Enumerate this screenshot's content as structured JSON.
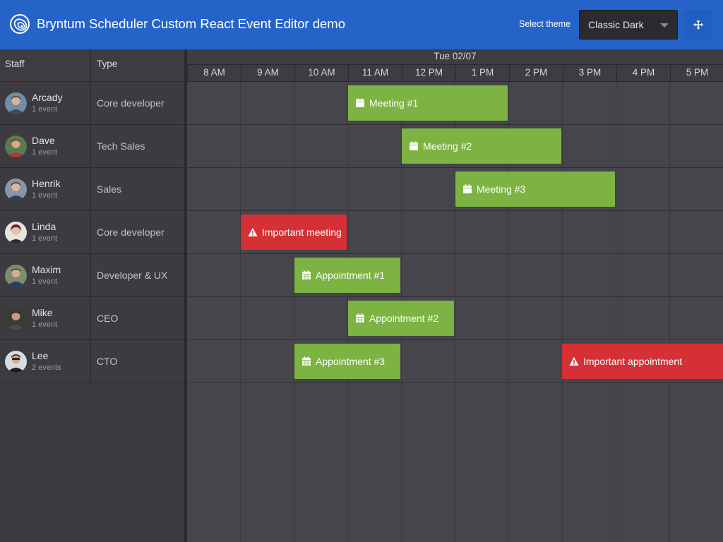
{
  "header": {
    "title": "Bryntum Scheduler Custom React Event Editor demo",
    "theme_label": "Select theme",
    "theme_value": "Classic Dark",
    "colors": {
      "background": "#2563c9",
      "button": "#1f5fc4"
    }
  },
  "grid": {
    "columns": {
      "staff": "Staff",
      "type": "Type"
    },
    "rows": [
      {
        "name": "Arcady",
        "events": "1 event",
        "type": "Core developer"
      },
      {
        "name": "Dave",
        "events": "1 event",
        "type": "Tech Sales"
      },
      {
        "name": "Henrik",
        "events": "1 event",
        "type": "Sales"
      },
      {
        "name": "Linda",
        "events": "1 event",
        "type": "Core developer"
      },
      {
        "name": "Maxim",
        "events": "1 event",
        "type": "Developer & UX"
      },
      {
        "name": "Mike",
        "events": "1 event",
        "type": "CEO"
      },
      {
        "name": "Lee",
        "events": "2 events",
        "type": "CTO"
      }
    ]
  },
  "timeline": {
    "date": "Tue 02/07",
    "hours": [
      "8 AM",
      "9 AM",
      "10 AM",
      "11 AM",
      "12 PM",
      "1 PM",
      "2 PM",
      "3 PM",
      "4 PM",
      "5 PM"
    ],
    "events": [
      {
        "row": 0,
        "name": "Meeting #1",
        "start": "11 AM",
        "end": "2 PM",
        "icon": "calendar-icon",
        "color": "#7cb342"
      },
      {
        "row": 1,
        "name": "Meeting #2",
        "start": "12 PM",
        "end": "3 PM",
        "icon": "calendar-icon",
        "color": "#7cb342"
      },
      {
        "row": 2,
        "name": "Meeting #3",
        "start": "1 PM",
        "end": "4 PM",
        "icon": "calendar-icon",
        "color": "#7cb342"
      },
      {
        "row": 3,
        "name": "Important meeting",
        "start": "9 AM",
        "end": "11 AM",
        "icon": "warning-icon",
        "color": "#d53035"
      },
      {
        "row": 4,
        "name": "Appointment #1",
        "start": "10 AM",
        "end": "12 PM",
        "icon": "calendar-grid-icon",
        "color": "#7cb342"
      },
      {
        "row": 5,
        "name": "Appointment #2",
        "start": "11 AM",
        "end": "1 PM",
        "icon": "calendar-grid-icon",
        "color": "#7cb342"
      },
      {
        "row": 6,
        "name": "Appointment #3",
        "start": "10 AM",
        "end": "12 PM",
        "icon": "calendar-grid-icon",
        "color": "#7cb342"
      },
      {
        "row": 6,
        "name": "Important appointment",
        "start": "3 PM",
        "end": "6 PM",
        "icon": "warning-icon",
        "color": "#d53035"
      }
    ]
  }
}
